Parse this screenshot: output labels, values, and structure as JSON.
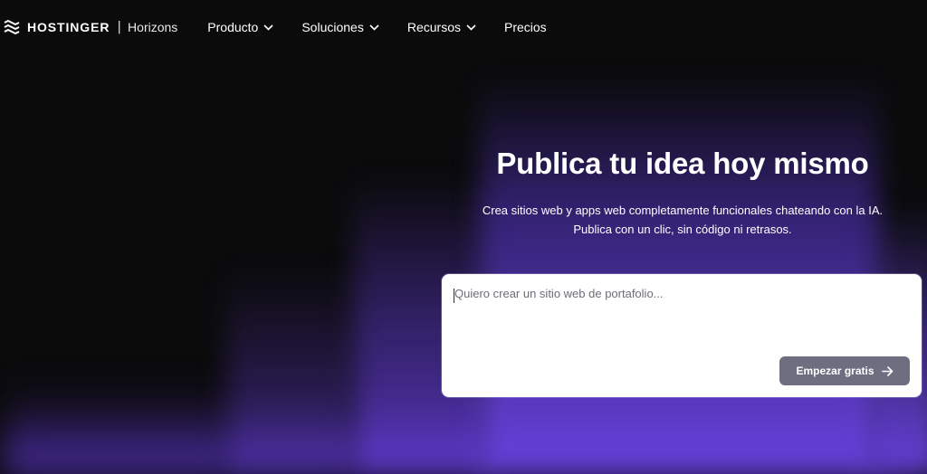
{
  "header": {
    "brand": "HOSTINGER",
    "separator": "|",
    "product": "Horizons",
    "nav": [
      {
        "label": "Producto",
        "has_dropdown": true
      },
      {
        "label": "Soluciones",
        "has_dropdown": true
      },
      {
        "label": "Recursos",
        "has_dropdown": true
      },
      {
        "label": "Precios",
        "has_dropdown": false
      }
    ]
  },
  "hero": {
    "title": "Publica tu idea hoy mismo",
    "subtitle_line1": "Crea sitios web y apps web completamente funcionales chateando con la IA.",
    "subtitle_line2": "Publica con un clic, sin código ni retrasos."
  },
  "prompt": {
    "placeholder": "Quiero crear un sitio web de portafolio...",
    "value": "",
    "button_label": "Empezar gratis"
  },
  "icons": {
    "logo": "hostinger-logo-icon",
    "dropdown": "chevron-down-icon",
    "button": "arrow-right-icon"
  },
  "colors": {
    "background": "#0b0b0c",
    "accent_glow": "#6e46e6",
    "button": "#6d6f80",
    "card": "#ffffff"
  }
}
